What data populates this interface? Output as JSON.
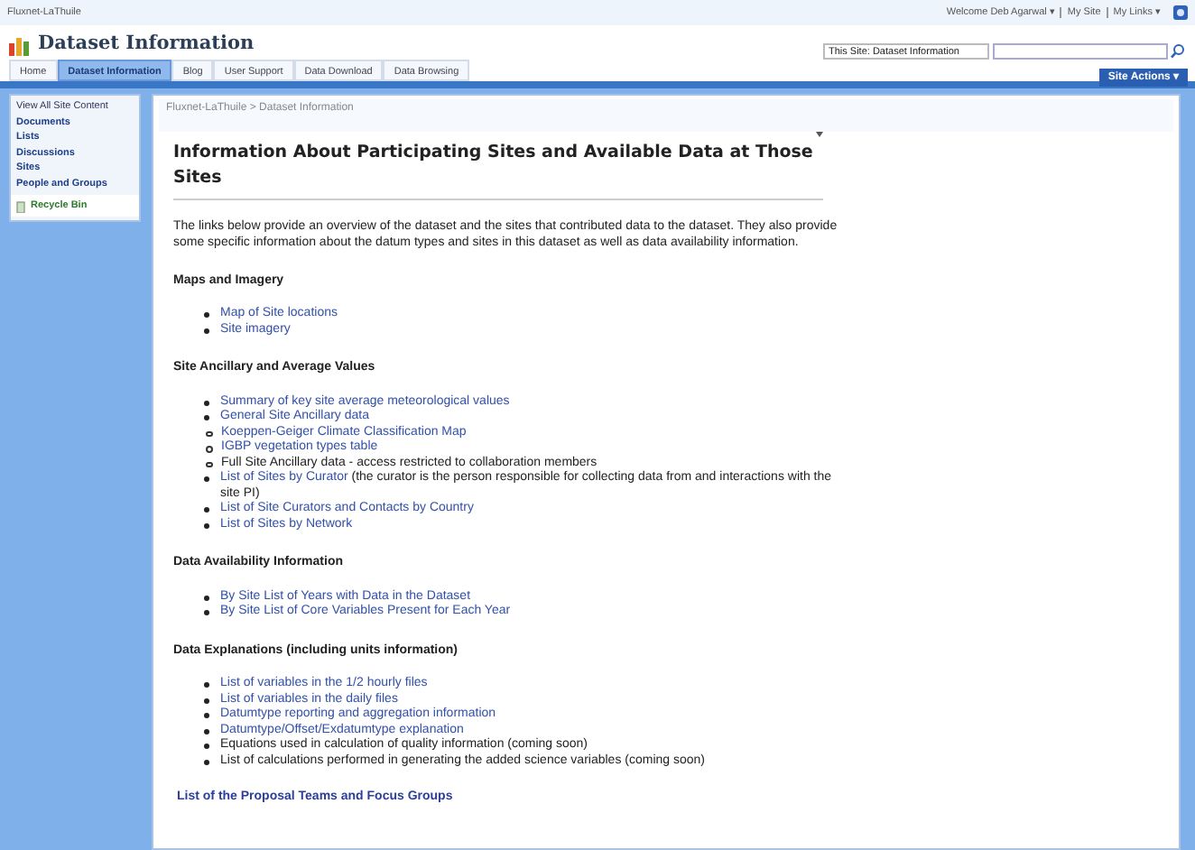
{
  "top_bar": {
    "site_name": "Fluxnet-LaThuile",
    "links": [
      "Welcome Deb Agarwal ▾",
      "My Site",
      "My Links ▾"
    ]
  },
  "header": {
    "title": "Dataset Information",
    "search_scope": "This Site: Dataset Information"
  },
  "tabs": [
    {
      "label": "Home",
      "selected": false
    },
    {
      "label": "Dataset Information",
      "selected": true
    },
    {
      "label": "Blog",
      "selected": false
    },
    {
      "label": "User Support",
      "selected": false
    },
    {
      "label": "Data Download",
      "selected": false
    },
    {
      "label": "Data Browsing",
      "selected": false
    }
  ],
  "site_actions": "Site Actions ▾",
  "quick_launch": [
    {
      "label": "View All Site Content",
      "kind": "plain"
    },
    {
      "label": "Documents",
      "kind": "heading"
    },
    {
      "label": "Lists",
      "kind": "heading"
    },
    {
      "label": "Discussions",
      "kind": "heading"
    },
    {
      "label": "Sites",
      "kind": "heading"
    },
    {
      "label": "People and Groups",
      "kind": "heading"
    },
    {
      "label": "Recycle Bin",
      "kind": "recycle"
    }
  ],
  "breadcrumb": "Fluxnet-LaThuile > Dataset Information",
  "content": {
    "title": "Information About Participating Sites and Available Data at Those Sites",
    "intro": "The links below provide an overview of the dataset and the sites that contributed data to the dataset.  They also provide some specific information about the datum types and sites in this dataset as well as data availability information.",
    "sections": [
      {
        "heading": "Maps and Imagery",
        "items": [
          {
            "link": "Map of Site locations"
          },
          {
            "link": "Site imagery"
          }
        ]
      },
      {
        "heading": "Site Ancillary and Average Values",
        "items": [
          {
            "link": "Summary of key site average meteorological values"
          },
          {
            "link": "General Site Ancillary data",
            "children": [
              {
                "link": "Koeppen-Geiger Climate Classification Map"
              },
              {
                "link": "IGBP vegetation types table"
              },
              {
                "text": "Full Site Ancillary data - access restricted to collaboration members"
              }
            ]
          },
          {
            "link": "List of Sites by Curator",
            "text": " (the curator is the person responsible for collecting data from and interactions with the site PI)"
          },
          {
            "link": "List of Site Curators and Contacts by Country"
          },
          {
            "link": "List of Sites by Network"
          }
        ]
      },
      {
        "heading": "Data Availability Information",
        "items": [
          {
            "link": "By Site List of Years with Data in the Dataset"
          },
          {
            "link": "By Site List of Core Variables Present for Each Year"
          }
        ]
      },
      {
        "heading": "Data Explanations (including units information)",
        "items": [
          {
            "link": "List of variables in the 1/2 hourly files"
          },
          {
            "link": "List of variables in the daily files"
          },
          {
            "link": "Datumtype reporting and aggregation information"
          },
          {
            "link": "Datumtype/Offset/Exdatumtype explanation"
          },
          {
            "text": "Equations used in calculation of quality information (coming soon)"
          },
          {
            "text": "List of calculations performed in generating the added science variables (coming soon)"
          }
        ]
      }
    ],
    "footer_link": "List of the Proposal Teams and Focus Groups"
  }
}
